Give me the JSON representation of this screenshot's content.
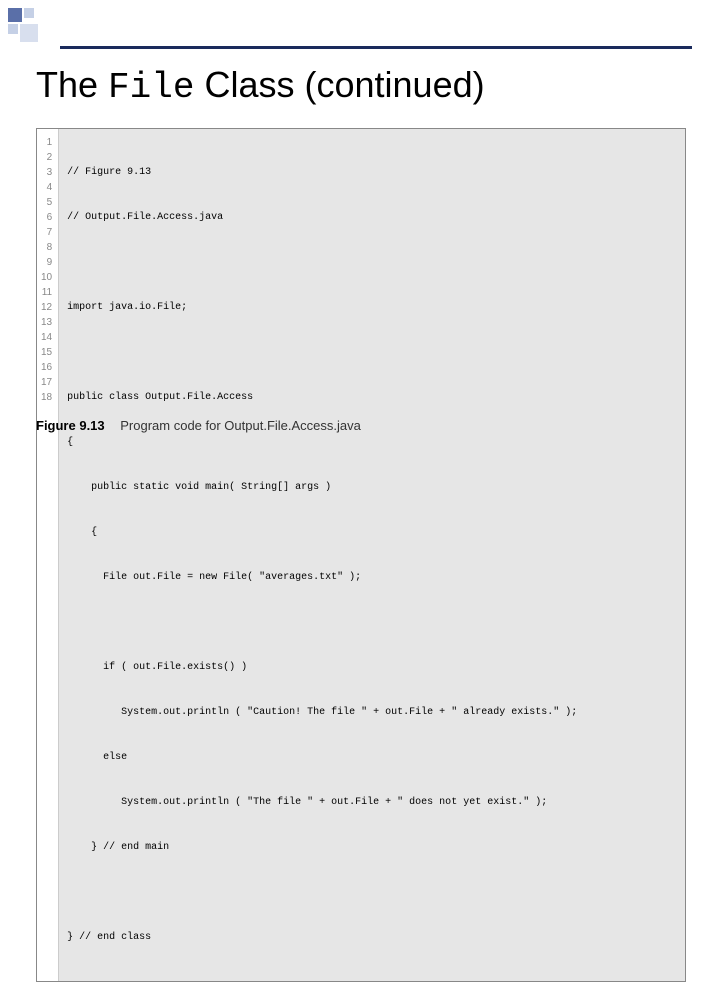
{
  "title": {
    "prefix": "The ",
    "mono": "File",
    "suffix": " Class (continued)"
  },
  "code": {
    "lines": [
      {
        "n": "1",
        "text": "// Figure 9.13"
      },
      {
        "n": "2",
        "text": "// Output.File.Access.java"
      },
      {
        "n": "3",
        "text": ""
      },
      {
        "n": "4",
        "text": "import java.io.File;"
      },
      {
        "n": "5",
        "text": ""
      },
      {
        "n": "6",
        "text": "public class Output.File.Access"
      },
      {
        "n": "7",
        "text": "{"
      },
      {
        "n": "8",
        "text": "    public static void main( String[] args )"
      },
      {
        "n": "9",
        "text": "    {"
      },
      {
        "n": "10",
        "text": "      File out.File = new File( \"averages.txt\" );"
      },
      {
        "n": "11",
        "text": ""
      },
      {
        "n": "12",
        "text": "      if ( out.File.exists() )"
      },
      {
        "n": "13",
        "text": "         System.out.println ( \"Caution! The file \" + out.File + \" already exists.\" );"
      },
      {
        "n": "14",
        "text": "      else"
      },
      {
        "n": "15",
        "text": "         System.out.println ( \"The file \" + out.File + \" does not yet exist.\" );"
      },
      {
        "n": "16",
        "text": "    } // end main"
      },
      {
        "n": "17",
        "text": ""
      },
      {
        "n": "18",
        "text": "} // end class"
      }
    ]
  },
  "caption": {
    "label": "Figure 9.13",
    "text": "Program code for Output.File.Access.java"
  }
}
